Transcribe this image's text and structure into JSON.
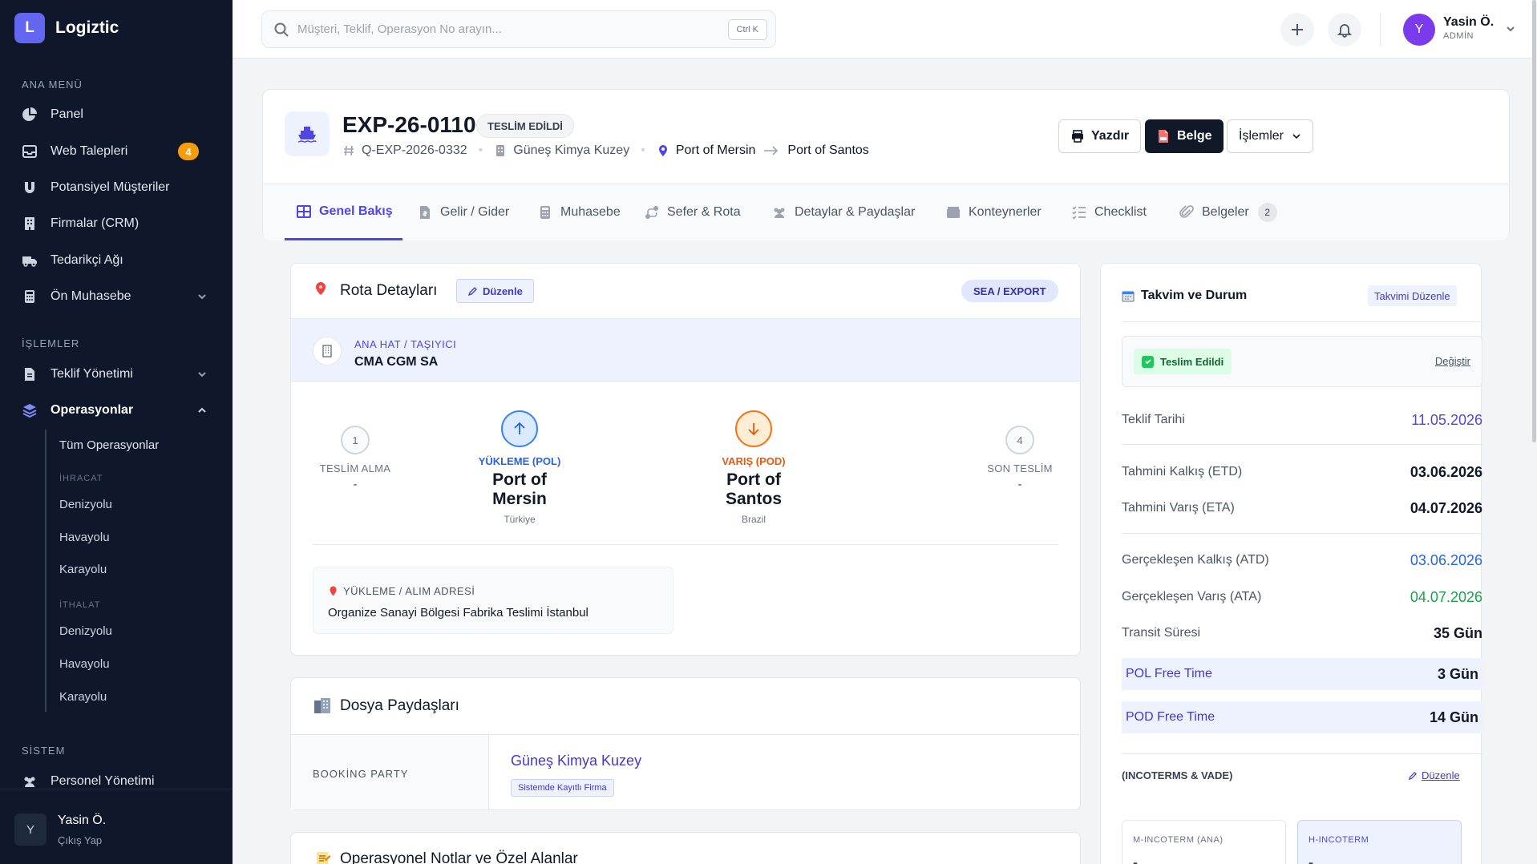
{
  "sidebar": {
    "brand_letter": "L",
    "brand_name": "Logiztic",
    "section_main": "ANA MENÜ",
    "section_ops": "İŞLEMLER",
    "section_system": "SİSTEM",
    "items": {
      "panel": "Panel",
      "web": "Web Talepleri",
      "web_count": "4",
      "leads": "Potansiyel Müşteriler",
      "crm": "Firmalar (CRM)",
      "suppliers": "Tedarikçi Ağı",
      "accounting": "Ön Muhasebe",
      "quotes": "Teklif Yönetimi",
      "operations": "Operasyonlar",
      "staff": "Personel Yönetimi"
    },
    "sub": {
      "all": "Tüm Operasyonlar",
      "export_group": "İHRACAT",
      "import_group": "İTHALAT",
      "sea": "Denizyolu",
      "air": "Havayolu",
      "road": "Karayolu"
    },
    "user": {
      "initial": "Y",
      "name": "Yasin Ö.",
      "logout": "Çıkış Yap"
    }
  },
  "topbar": {
    "search_placeholder": "Müşteri, Teklif, Operasyon No arayın...",
    "shortcut": "Ctrl K",
    "user_initial": "Y",
    "user_name": "Yasin Ö.",
    "user_role": "ADMİN"
  },
  "header": {
    "title": "EXP-26-0110",
    "status": "TESLİM EDİLDİ",
    "quote_no": "Q-EXP-2026-0332",
    "company": "Güneş Kimya Kuzey",
    "origin": "Port of Mersin",
    "destination": "Port of Santos",
    "print_label": "Yazdır",
    "doc_label": "Belge",
    "actions_label": "İşlemler"
  },
  "tabs": [
    {
      "label": "Genel Bakış"
    },
    {
      "label": "Gelir / Gider"
    },
    {
      "label": "Muhasebe"
    },
    {
      "label": "Sefer & Rota"
    },
    {
      "label": "Detaylar & Paydaşlar"
    },
    {
      "label": "Konteynerler"
    },
    {
      "label": "Checklist"
    },
    {
      "label": "Belgeler",
      "badge": "2"
    }
  ],
  "route": {
    "title": "Rota Detayları",
    "edit_label": "Düzenle",
    "mode_pill": "SEA / EXPORT",
    "carrier_label": "ANA HAT / TAŞIYICI",
    "carrier_value": "CMA CGM SA",
    "pickup": {
      "num": "1",
      "label": "TESLİM ALMA",
      "value": "-"
    },
    "pol": {
      "label": "YÜKLEME (POL)",
      "name": "Port of Mersin",
      "country": "Türkiye"
    },
    "pod": {
      "label": "VARIŞ (POD)",
      "name": "Port of Santos",
      "country": "Brazil"
    },
    "delivery": {
      "num": "4",
      "label": "SON TESLİM",
      "value": "-"
    },
    "address_label": "YÜKLEME / ALIM ADRESİ",
    "address_value": "Organize Sanayi Bölgesi Fabrika Teslimi İstanbul"
  },
  "stakeholders": {
    "title": "Dosya Paydaşları",
    "role": "BOOKİNG PARTY",
    "name": "Güneş Kimya Kuzey",
    "tag": "Sistemde Kayıtlı Firma"
  },
  "notes": {
    "title": "Operasyonel Notlar ve Özel Alanlar"
  },
  "calendar": {
    "title": "Takvim ve Durum",
    "edit_label": "Takvimi Düzenle",
    "status": "Teslim Edildi",
    "change_label": "Değiştir",
    "rows": {
      "quote_date": {
        "label": "Teklif Tarihi",
        "value": "11.05.2026"
      },
      "etd": {
        "label": "Tahmini Kalkış (ETD)",
        "value": "03.06.2026"
      },
      "eta": {
        "label": "Tahmini Varış (ETA)",
        "value": "04.07.2026"
      },
      "atd": {
        "label": "Gerçekleşen Kalkış (ATD)",
        "value": "03.06.2026"
      },
      "ata": {
        "label": "Gerçekleşen Varış (ATA)",
        "value": "04.07.2026"
      },
      "transit": {
        "label": "Transit Süresi",
        "value": "35 Gün"
      },
      "pol_free": {
        "label": "POL Free Time",
        "value": "3 Gün"
      },
      "pod_free": {
        "label": "POD Free Time",
        "value": "14 Gün"
      }
    },
    "incoterm_title": "(INCOTERMS & VADE)",
    "incoterm_edit": "Düzenle",
    "m_incoterm_label": "M-INCOTERM (ANA)",
    "m_incoterm_value": "-",
    "h_incoterm_label": "H-INCOTERM",
    "h_incoterm_value": "-"
  },
  "colors": {
    "accent": "#4f46e5",
    "sidebar_bg": "#0f172a",
    "pol_blue": "#2563eb",
    "pod_orange": "#ea580c",
    "success": "#16a34a"
  }
}
